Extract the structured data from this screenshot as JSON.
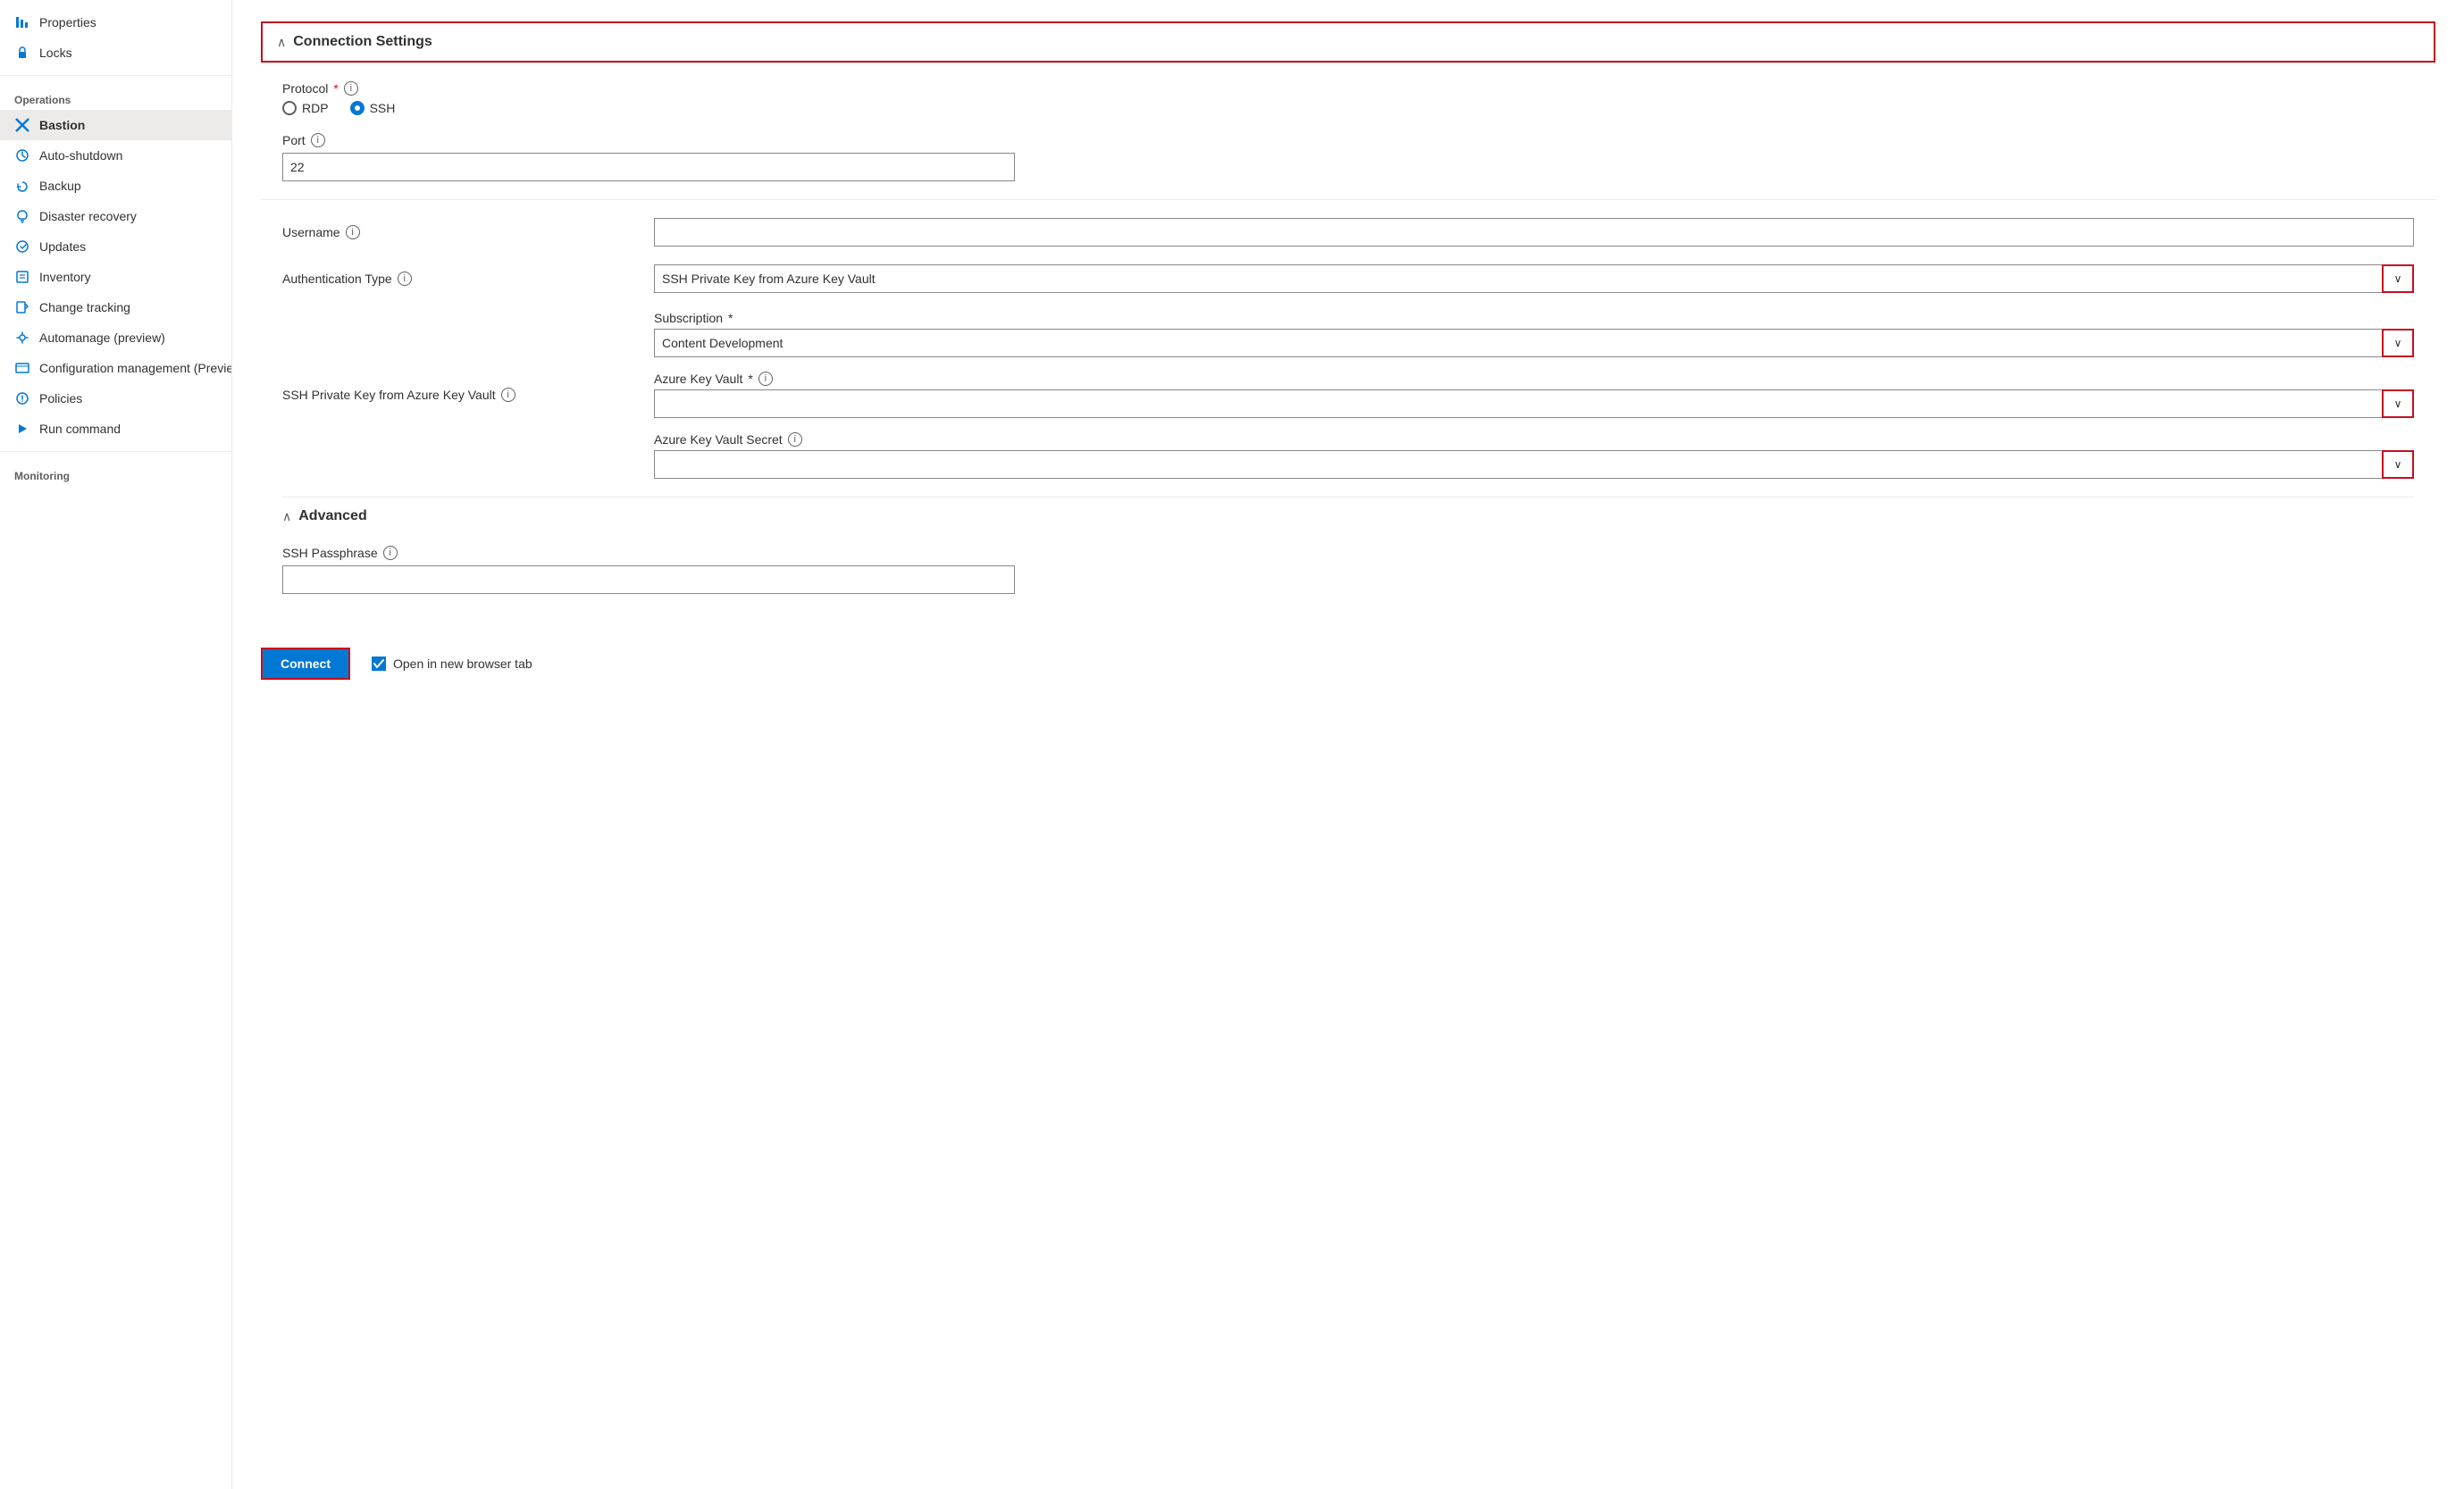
{
  "sidebar": {
    "items": [
      {
        "id": "properties",
        "label": "Properties",
        "icon": "📊",
        "iconColor": "blue"
      },
      {
        "id": "locks",
        "label": "Locks",
        "icon": "🔒",
        "iconColor": "blue"
      }
    ],
    "sections": [
      {
        "title": "Operations",
        "items": [
          {
            "id": "bastion",
            "label": "Bastion",
            "icon": "✕",
            "iconColor": "blue",
            "active": true
          },
          {
            "id": "auto-shutdown",
            "label": "Auto-shutdown",
            "icon": "⏰",
            "iconColor": "blue"
          },
          {
            "id": "backup",
            "label": "Backup",
            "icon": "☁",
            "iconColor": "blue"
          },
          {
            "id": "disaster-recovery",
            "label": "Disaster recovery",
            "icon": "↺",
            "iconColor": "blue"
          },
          {
            "id": "updates",
            "label": "Updates",
            "icon": "⚙",
            "iconColor": "blue"
          },
          {
            "id": "inventory",
            "label": "Inventory",
            "icon": "📋",
            "iconColor": "blue"
          },
          {
            "id": "change-tracking",
            "label": "Change tracking",
            "icon": "📄",
            "iconColor": "blue"
          },
          {
            "id": "automanage",
            "label": "Automanage (preview)",
            "icon": "🔄",
            "iconColor": "blue"
          },
          {
            "id": "config-mgmt",
            "label": "Configuration management (Preview)",
            "icon": "🖥",
            "iconColor": "blue"
          },
          {
            "id": "policies",
            "label": "Policies",
            "icon": "⚙",
            "iconColor": "blue"
          },
          {
            "id": "run-command",
            "label": "Run command",
            "icon": "▷",
            "iconColor": "blue"
          }
        ]
      },
      {
        "title": "Monitoring",
        "items": []
      }
    ]
  },
  "main": {
    "connection_settings": {
      "title": "Connection Settings",
      "protocol_label": "Protocol",
      "rdp_label": "RDP",
      "ssh_label": "SSH",
      "port_label": "Port",
      "port_value": "22",
      "username_label": "Username",
      "username_placeholder": "",
      "auth_type_label": "Authentication Type",
      "auth_type_value": "SSH Private Key from Azure Key Vault",
      "ssh_key_label": "SSH Private Key from Azure Key Vault",
      "subscription_label": "Subscription",
      "subscription_required": "*",
      "subscription_value": "Content Development",
      "azure_key_vault_label": "Azure Key Vault",
      "azure_key_vault_required": "*",
      "azure_key_vault_value": "",
      "azure_key_vault_secret_label": "Azure Key Vault Secret",
      "azure_key_vault_secret_value": ""
    },
    "advanced": {
      "title": "Advanced",
      "ssh_passphrase_label": "SSH Passphrase",
      "ssh_passphrase_value": ""
    },
    "footer": {
      "connect_label": "Connect",
      "open_new_tab_label": "Open in new browser tab"
    }
  },
  "icons": {
    "chevron_up": "∧",
    "chevron_down": "∨",
    "info": "i",
    "check": "✓"
  }
}
